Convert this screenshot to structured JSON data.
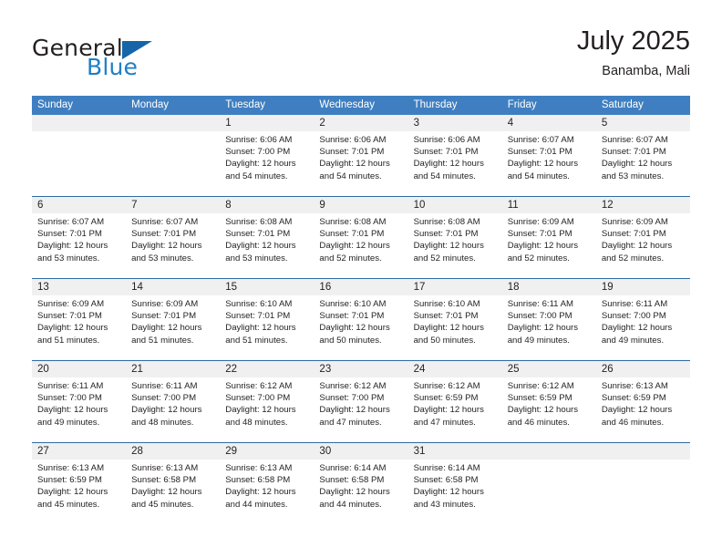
{
  "brand": {
    "name_part1": "General",
    "name_part2": "Blue",
    "flag_icon": "blue-triangle-flag"
  },
  "header": {
    "title": "July 2025",
    "subtitle": "Banamba, Mali"
  },
  "colors": {
    "header_blue": "#3f7fc1",
    "row_divider_blue": "#2e6ca4",
    "number_band_gray": "#f0f0f0",
    "brand_blue": "#1f7fc4",
    "text": "#231f20"
  },
  "weekdays": [
    "Sunday",
    "Monday",
    "Tuesday",
    "Wednesday",
    "Thursday",
    "Friday",
    "Saturday"
  ],
  "weeks": [
    {
      "days": [
        {
          "num": "",
          "l1": "",
          "l2": "",
          "l3": "",
          "l4": "",
          "empty": true
        },
        {
          "num": "",
          "l1": "",
          "l2": "",
          "l3": "",
          "l4": "",
          "empty": true
        },
        {
          "num": "1",
          "l1": "Sunrise: 6:06 AM",
          "l2": "Sunset: 7:00 PM",
          "l3": "Daylight: 12 hours",
          "l4": "and 54 minutes."
        },
        {
          "num": "2",
          "l1": "Sunrise: 6:06 AM",
          "l2": "Sunset: 7:01 PM",
          "l3": "Daylight: 12 hours",
          "l4": "and 54 minutes."
        },
        {
          "num": "3",
          "l1": "Sunrise: 6:06 AM",
          "l2": "Sunset: 7:01 PM",
          "l3": "Daylight: 12 hours",
          "l4": "and 54 minutes."
        },
        {
          "num": "4",
          "l1": "Sunrise: 6:07 AM",
          "l2": "Sunset: 7:01 PM",
          "l3": "Daylight: 12 hours",
          "l4": "and 54 minutes."
        },
        {
          "num": "5",
          "l1": "Sunrise: 6:07 AM",
          "l2": "Sunset: 7:01 PM",
          "l3": "Daylight: 12 hours",
          "l4": "and 53 minutes."
        }
      ]
    },
    {
      "days": [
        {
          "num": "6",
          "l1": "Sunrise: 6:07 AM",
          "l2": "Sunset: 7:01 PM",
          "l3": "Daylight: 12 hours",
          "l4": "and 53 minutes."
        },
        {
          "num": "7",
          "l1": "Sunrise: 6:07 AM",
          "l2": "Sunset: 7:01 PM",
          "l3": "Daylight: 12 hours",
          "l4": "and 53 minutes."
        },
        {
          "num": "8",
          "l1": "Sunrise: 6:08 AM",
          "l2": "Sunset: 7:01 PM",
          "l3": "Daylight: 12 hours",
          "l4": "and 53 minutes."
        },
        {
          "num": "9",
          "l1": "Sunrise: 6:08 AM",
          "l2": "Sunset: 7:01 PM",
          "l3": "Daylight: 12 hours",
          "l4": "and 52 minutes."
        },
        {
          "num": "10",
          "l1": "Sunrise: 6:08 AM",
          "l2": "Sunset: 7:01 PM",
          "l3": "Daylight: 12 hours",
          "l4": "and 52 minutes."
        },
        {
          "num": "11",
          "l1": "Sunrise: 6:09 AM",
          "l2": "Sunset: 7:01 PM",
          "l3": "Daylight: 12 hours",
          "l4": "and 52 minutes."
        },
        {
          "num": "12",
          "l1": "Sunrise: 6:09 AM",
          "l2": "Sunset: 7:01 PM",
          "l3": "Daylight: 12 hours",
          "l4": "and 52 minutes."
        }
      ]
    },
    {
      "days": [
        {
          "num": "13",
          "l1": "Sunrise: 6:09 AM",
          "l2": "Sunset: 7:01 PM",
          "l3": "Daylight: 12 hours",
          "l4": "and 51 minutes."
        },
        {
          "num": "14",
          "l1": "Sunrise: 6:09 AM",
          "l2": "Sunset: 7:01 PM",
          "l3": "Daylight: 12 hours",
          "l4": "and 51 minutes."
        },
        {
          "num": "15",
          "l1": "Sunrise: 6:10 AM",
          "l2": "Sunset: 7:01 PM",
          "l3": "Daylight: 12 hours",
          "l4": "and 51 minutes."
        },
        {
          "num": "16",
          "l1": "Sunrise: 6:10 AM",
          "l2": "Sunset: 7:01 PM",
          "l3": "Daylight: 12 hours",
          "l4": "and 50 minutes."
        },
        {
          "num": "17",
          "l1": "Sunrise: 6:10 AM",
          "l2": "Sunset: 7:01 PM",
          "l3": "Daylight: 12 hours",
          "l4": "and 50 minutes."
        },
        {
          "num": "18",
          "l1": "Sunrise: 6:11 AM",
          "l2": "Sunset: 7:00 PM",
          "l3": "Daylight: 12 hours",
          "l4": "and 49 minutes."
        },
        {
          "num": "19",
          "l1": "Sunrise: 6:11 AM",
          "l2": "Sunset: 7:00 PM",
          "l3": "Daylight: 12 hours",
          "l4": "and 49 minutes."
        }
      ]
    },
    {
      "days": [
        {
          "num": "20",
          "l1": "Sunrise: 6:11 AM",
          "l2": "Sunset: 7:00 PM",
          "l3": "Daylight: 12 hours",
          "l4": "and 49 minutes."
        },
        {
          "num": "21",
          "l1": "Sunrise: 6:11 AM",
          "l2": "Sunset: 7:00 PM",
          "l3": "Daylight: 12 hours",
          "l4": "and 48 minutes."
        },
        {
          "num": "22",
          "l1": "Sunrise: 6:12 AM",
          "l2": "Sunset: 7:00 PM",
          "l3": "Daylight: 12 hours",
          "l4": "and 48 minutes."
        },
        {
          "num": "23",
          "l1": "Sunrise: 6:12 AM",
          "l2": "Sunset: 7:00 PM",
          "l3": "Daylight: 12 hours",
          "l4": "and 47 minutes."
        },
        {
          "num": "24",
          "l1": "Sunrise: 6:12 AM",
          "l2": "Sunset: 6:59 PM",
          "l3": "Daylight: 12 hours",
          "l4": "and 47 minutes."
        },
        {
          "num": "25",
          "l1": "Sunrise: 6:12 AM",
          "l2": "Sunset: 6:59 PM",
          "l3": "Daylight: 12 hours",
          "l4": "and 46 minutes."
        },
        {
          "num": "26",
          "l1": "Sunrise: 6:13 AM",
          "l2": "Sunset: 6:59 PM",
          "l3": "Daylight: 12 hours",
          "l4": "and 46 minutes."
        }
      ]
    },
    {
      "days": [
        {
          "num": "27",
          "l1": "Sunrise: 6:13 AM",
          "l2": "Sunset: 6:59 PM",
          "l3": "Daylight: 12 hours",
          "l4": "and 45 minutes."
        },
        {
          "num": "28",
          "l1": "Sunrise: 6:13 AM",
          "l2": "Sunset: 6:58 PM",
          "l3": "Daylight: 12 hours",
          "l4": "and 45 minutes."
        },
        {
          "num": "29",
          "l1": "Sunrise: 6:13 AM",
          "l2": "Sunset: 6:58 PM",
          "l3": "Daylight: 12 hours",
          "l4": "and 44 minutes."
        },
        {
          "num": "30",
          "l1": "Sunrise: 6:14 AM",
          "l2": "Sunset: 6:58 PM",
          "l3": "Daylight: 12 hours",
          "l4": "and 44 minutes."
        },
        {
          "num": "31",
          "l1": "Sunrise: 6:14 AM",
          "l2": "Sunset: 6:58 PM",
          "l3": "Daylight: 12 hours",
          "l4": "and 43 minutes."
        },
        {
          "num": "",
          "l1": "",
          "l2": "",
          "l3": "",
          "l4": "",
          "empty": true
        },
        {
          "num": "",
          "l1": "",
          "l2": "",
          "l3": "",
          "l4": "",
          "empty": true
        }
      ]
    }
  ]
}
